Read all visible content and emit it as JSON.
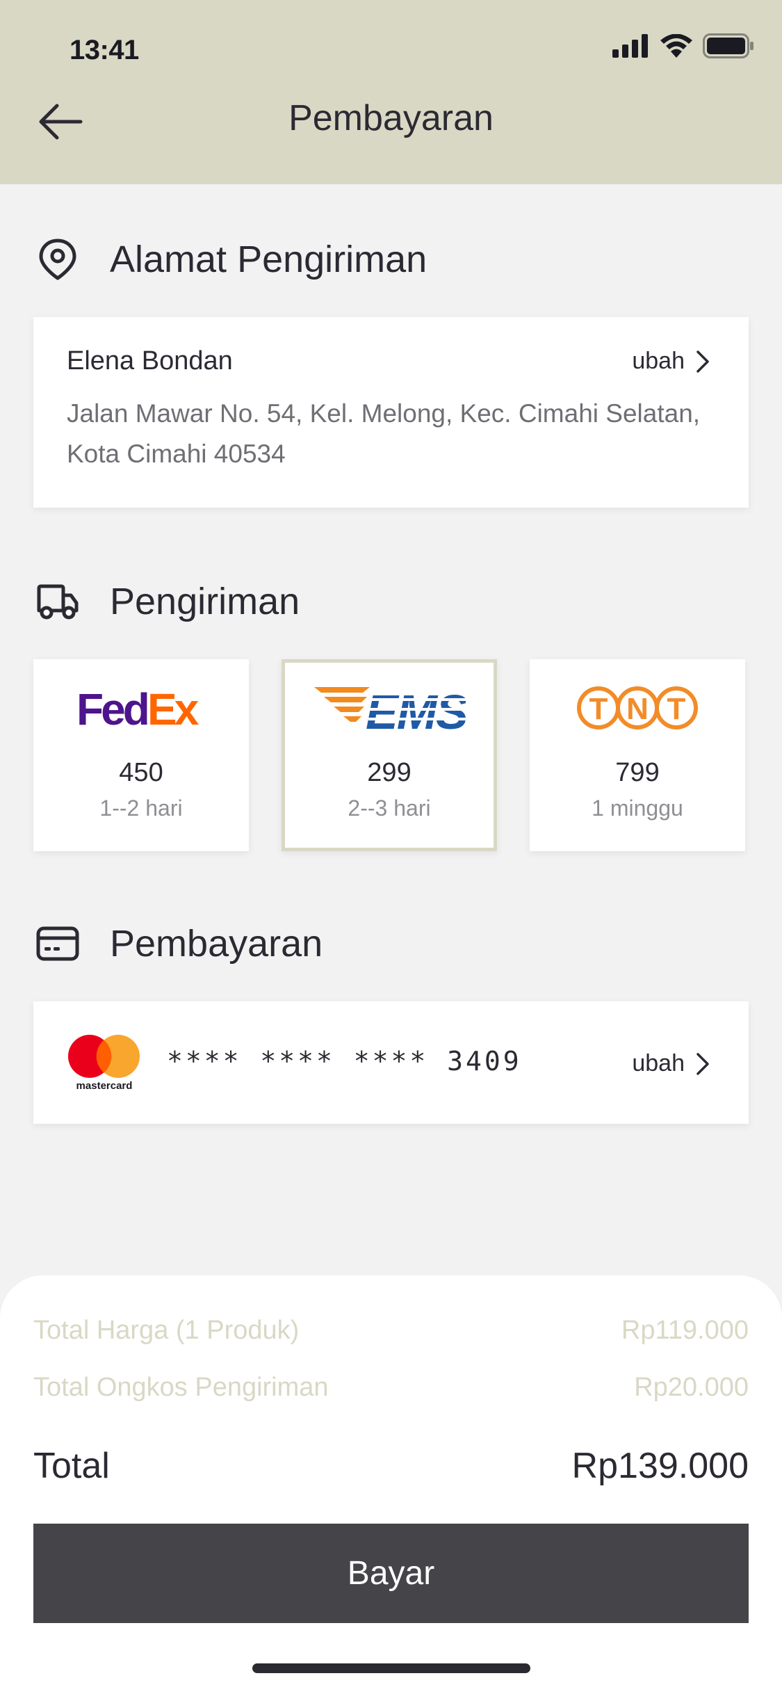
{
  "status_bar": {
    "time": "13:41",
    "icons": [
      "signal-icon",
      "wifi-icon",
      "battery-icon"
    ]
  },
  "header": {
    "title": "Pembayaran",
    "back_icon": "arrow-left-icon",
    "background": "#d9d8c5"
  },
  "address_section": {
    "title": "Alamat Pengiriman",
    "icon": "location-pin-icon",
    "name": "Elena Bondan",
    "change_label": "ubah",
    "address": "Jalan Mawar No. 54, Kel. Melong, Kec. Cimahi Selatan, Kota Cimahi 40534"
  },
  "shipping_section": {
    "title": "Pengiriman",
    "icon": "truck-icon",
    "options": [
      {
        "logo": "FedEx",
        "price": "450",
        "eta": "1--2 hari",
        "selected": false
      },
      {
        "logo": "EMS",
        "price": "299",
        "eta": "2--3 hari",
        "selected": true
      },
      {
        "logo": "TNT",
        "price": "799",
        "eta": "1 minggu",
        "selected": false
      }
    ]
  },
  "payment_section": {
    "title": "Pembayaran",
    "icon": "credit-card-icon",
    "card_brand": "mastercard",
    "card_number": "**** **** **** 3409",
    "change_label": "ubah"
  },
  "summary": {
    "total_price_label": "Total Harga (1 Produk)",
    "total_price_value": "Rp119.000",
    "shipping_cost_label": "Total Ongkos Pengiriman",
    "shipping_cost_value": "Rp20.000",
    "total_label": "Total",
    "total_value": "Rp139.000"
  },
  "pay_button": {
    "label": "Bayar",
    "background": "#454448"
  },
  "colors": {
    "accent": "#d9d8c5",
    "fedex_purple": "#4d148c",
    "fedex_orange": "#ff6600",
    "ems_orange": "#f28a1e",
    "ems_blue": "#1f5aa6",
    "tnt_orange": "#f28c28",
    "mastercard_red": "#eb001b",
    "mastercard_yellow": "#f79e1b"
  }
}
